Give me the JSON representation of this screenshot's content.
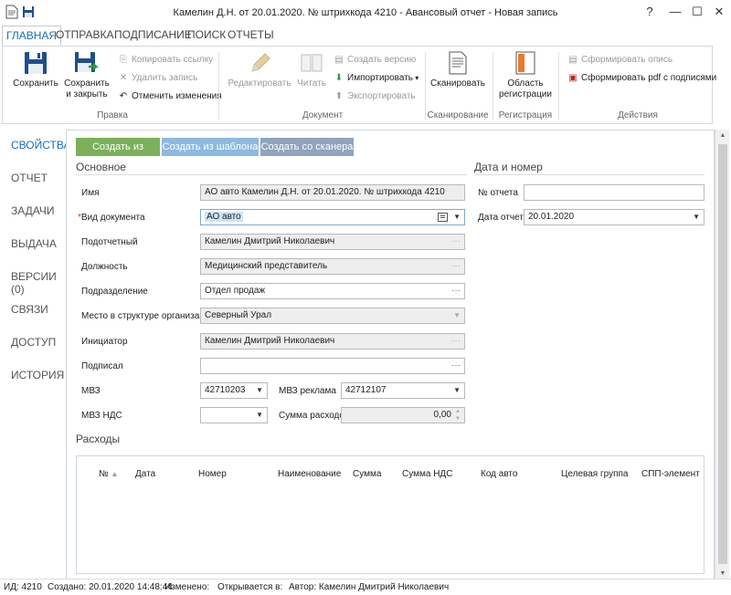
{
  "window": {
    "title": "Камелин Д.Н. от 20.01.2020. № штрихкода 4210 - Авансовый отчет - Новая запись",
    "help": "?",
    "minimize": "—",
    "maximize": "☐",
    "close": "✕"
  },
  "tabs": [
    "ГЛАВНАЯ",
    "ОТПРАВКА",
    "ПОДПИСАНИЕ",
    "ПОИСК",
    "ОТЧЕТЫ"
  ],
  "ribbon": {
    "save": "Сохранить",
    "save_close_1": "Сохранить",
    "save_close_2": "и закрыть",
    "copy_link": "Копировать ссылку",
    "delete_record": "Удалить запись",
    "undo_changes": "Отменить изменения",
    "group_edit": "Правка",
    "edit": "Редактировать",
    "read": "Читать",
    "create_version": "Создать версию",
    "import": "Импортировать",
    "export": "Экспортировать",
    "group_document": "Документ",
    "scan": "Сканировать",
    "group_scan": "Сканирование",
    "reg_area_1": "Область",
    "reg_area_2": "регистрации",
    "group_registration": "Регистрация",
    "make_inventory": "Сформировать опись",
    "make_pdf": "Сформировать pdf с подписями",
    "group_actions": "Действия"
  },
  "nav": [
    "СВОЙСТВА",
    "ОТЧЕТ",
    "ЗАДАЧИ",
    "ВЫДАЧА",
    "ВЕРСИИ (0)",
    "СВЯЗИ",
    "ДОСТУП",
    "ИСТОРИЯ"
  ],
  "create_buttons": {
    "from_file": "Создать из файла",
    "from_template": "Создать из шаблона",
    "from_scanner": "Создать со сканера"
  },
  "main_section": "Основное",
  "date_section": "Дата и номер",
  "fields": {
    "name_label": "Имя",
    "name_value": "АО авто Камелин Д.Н. от 20.01.2020. № штрихкода 4210",
    "doctype_req": "*",
    "doctype_label": "Вид документа",
    "doctype_value": "АО авто",
    "accountable_label": "Подотчетный",
    "accountable_value": "Камелин Дмитрий Николаевич",
    "position_label": "Должность",
    "position_value": "Медицинский представитель",
    "department_label": "Подразделение",
    "department_value": "Отдел продаж",
    "org_place_label": "Место в структуре организации",
    "org_place_value": "Северный Урал",
    "initiator_label": "Инициатор",
    "initiator_value": "Камелин Дмитрий Николаевич",
    "signed_label": "Подписал",
    "signed_value": "",
    "mvz_label": "МВЗ",
    "mvz_value": "42710203",
    "mvz_ad_label": "МВЗ реклама",
    "mvz_ad_value": "42712107",
    "mvz_vat_label": "МВЗ НДС",
    "mvz_vat_value": "",
    "expense_sum_label": "Сумма расходов",
    "expense_sum_value": "0,00",
    "report_no_label": "№ отчета",
    "report_no_value": "",
    "report_date_label": "Дата отчета",
    "report_date_value": "20.01.2020"
  },
  "expenses": {
    "title": "Расходы",
    "columns": [
      "№",
      "Дата",
      "Номер",
      "Наименование",
      "Сумма",
      "Сумма НДС",
      "Код авто",
      "Целевая группа",
      "СПП-элемент"
    ],
    "sort_indicator": "▲"
  },
  "status": {
    "id": "ИД: 4210",
    "created": "Создано: 20.01.2020 14:48:44",
    "modified": "Изменено:",
    "opens_in": "Открывается в:",
    "author": "Автор: Камелин Дмитрий Николаевич"
  },
  "colors": {
    "accent": "#1a6fb4",
    "from_file_btn": "#7cb05a",
    "from_template_btn": "#8db9e0",
    "from_scanner_btn": "#8fa4bd"
  }
}
